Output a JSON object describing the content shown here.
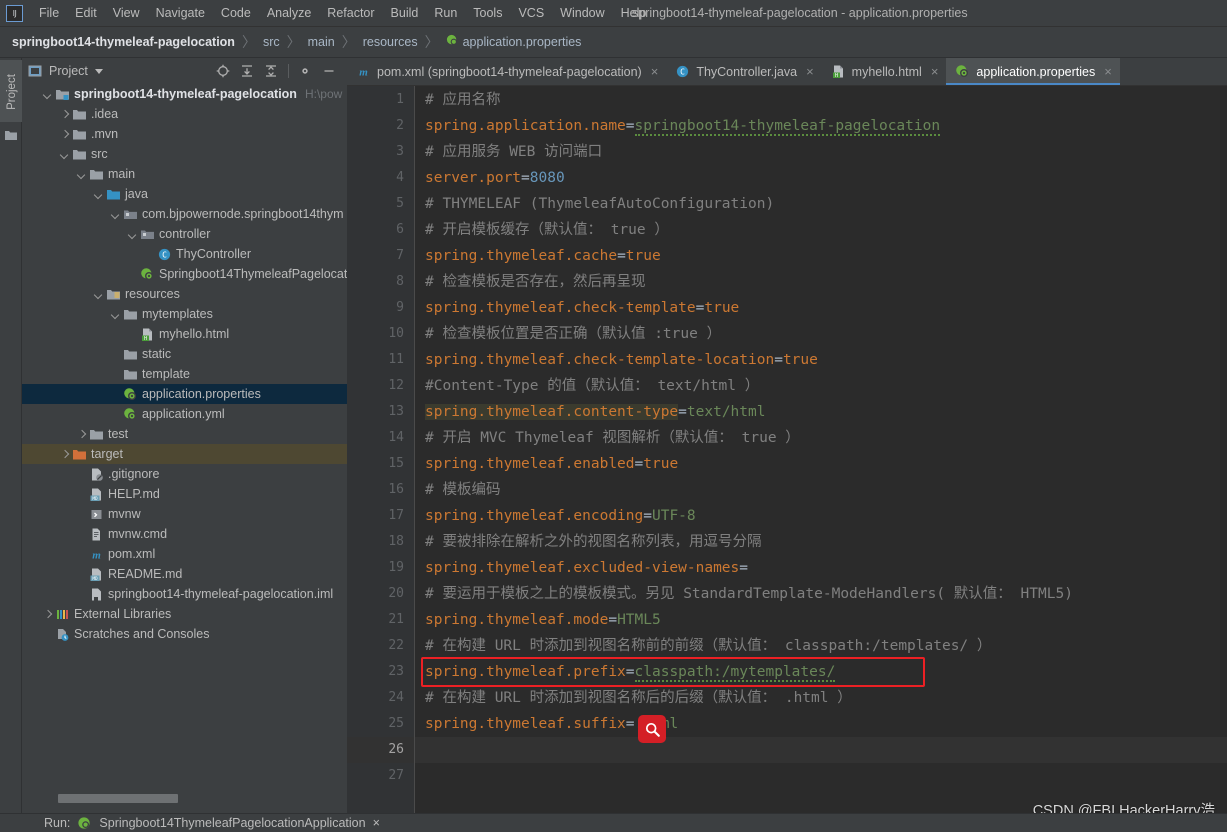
{
  "window": {
    "title": "springboot14-thymeleaf-pagelocation - application.properties",
    "logo": "intellij-idea-logo"
  },
  "menubar": {
    "items": [
      {
        "label": "File"
      },
      {
        "label": "Edit"
      },
      {
        "label": "View"
      },
      {
        "label": "Navigate"
      },
      {
        "label": "Code"
      },
      {
        "label": "Analyze"
      },
      {
        "label": "Refactor"
      },
      {
        "label": "Build"
      },
      {
        "label": "Run"
      },
      {
        "label": "Tools"
      },
      {
        "label": "VCS"
      },
      {
        "label": "Window"
      },
      {
        "label": "Help"
      }
    ]
  },
  "breadcrumb": {
    "items": [
      "springboot14-thymeleaf-pagelocation",
      "src",
      "main",
      "resources",
      "application.properties"
    ]
  },
  "toolstrip": {
    "project_tab": "Project"
  },
  "project_panel": {
    "title": "Project",
    "tools": [
      "locate-icon",
      "expand-all-icon",
      "collapse-all-icon",
      "settings-icon",
      "hide-icon"
    ],
    "tree": [
      {
        "depth": 0,
        "arrow": "down",
        "icon": "module-folder-icon",
        "label": "springboot14-thymeleaf-pagelocation",
        "bold": true,
        "hint": "H:\\pow",
        "state": "none"
      },
      {
        "depth": 1,
        "arrow": "right",
        "icon": "folder-icon",
        "label": ".idea",
        "state": "none"
      },
      {
        "depth": 1,
        "arrow": "right",
        "icon": "folder-icon",
        "label": ".mvn",
        "state": "none"
      },
      {
        "depth": 1,
        "arrow": "down",
        "icon": "folder-icon",
        "label": "src",
        "state": "none"
      },
      {
        "depth": 2,
        "arrow": "down",
        "icon": "folder-icon",
        "label": "main",
        "state": "none"
      },
      {
        "depth": 3,
        "arrow": "down",
        "icon": "source-folder-icon",
        "label": "java",
        "state": "none"
      },
      {
        "depth": 4,
        "arrow": "down",
        "icon": "package-icon",
        "label": "com.bjpowernode.springboot14thym",
        "state": "none"
      },
      {
        "depth": 5,
        "arrow": "down",
        "icon": "package-icon",
        "label": "controller",
        "state": "none"
      },
      {
        "depth": 6,
        "arrow": "none",
        "icon": "java-class-icon",
        "label": "ThyController",
        "state": "none"
      },
      {
        "depth": 5,
        "arrow": "none",
        "icon": "spring-boot-icon",
        "label": "Springboot14ThymeleafPagelocat",
        "state": "none"
      },
      {
        "depth": 3,
        "arrow": "down",
        "icon": "resources-folder-icon",
        "label": "resources",
        "state": "none"
      },
      {
        "depth": 4,
        "arrow": "down",
        "icon": "folder-icon",
        "label": "mytemplates",
        "state": "none"
      },
      {
        "depth": 5,
        "arrow": "none",
        "icon": "html-file-icon",
        "label": "myhello.html",
        "state": "none"
      },
      {
        "depth": 4,
        "arrow": "none",
        "icon": "folder-icon",
        "label": "static",
        "state": "none"
      },
      {
        "depth": 4,
        "arrow": "none",
        "icon": "folder-icon",
        "label": "template",
        "state": "none"
      },
      {
        "depth": 4,
        "arrow": "none",
        "icon": "spring-boot-icon",
        "label": "application.properties",
        "state": "selected"
      },
      {
        "depth": 4,
        "arrow": "none",
        "icon": "spring-boot-icon",
        "label": "application.yml",
        "state": "none"
      },
      {
        "depth": 2,
        "arrow": "right",
        "icon": "folder-icon",
        "label": "test",
        "state": "none"
      },
      {
        "depth": 1,
        "arrow": "right",
        "icon": "target-folder-icon",
        "label": "target",
        "state": "highlighted"
      },
      {
        "depth": 2,
        "arrow": "none",
        "icon": "gitignore-icon",
        "label": ".gitignore",
        "state": "none"
      },
      {
        "depth": 2,
        "arrow": "none",
        "icon": "markdown-icon",
        "label": "HELP.md",
        "state": "none"
      },
      {
        "depth": 2,
        "arrow": "none",
        "icon": "script-icon",
        "label": "mvnw",
        "state": "none"
      },
      {
        "depth": 2,
        "arrow": "none",
        "icon": "cmd-file-icon",
        "label": "mvnw.cmd",
        "state": "none"
      },
      {
        "depth": 2,
        "arrow": "none",
        "icon": "maven-icon",
        "label": "pom.xml",
        "state": "none"
      },
      {
        "depth": 2,
        "arrow": "none",
        "icon": "markdown-icon",
        "label": "README.md",
        "state": "none"
      },
      {
        "depth": 2,
        "arrow": "none",
        "icon": "iml-file-icon",
        "label": "springboot14-thymeleaf-pagelocation.iml",
        "state": "none"
      },
      {
        "depth": 0,
        "arrow": "right",
        "icon": "external-libraries-icon",
        "label": "External Libraries",
        "state": "none"
      },
      {
        "depth": 0,
        "arrow": "none",
        "icon": "scratches-icon",
        "label": "Scratches and Consoles",
        "state": "none"
      }
    ]
  },
  "editor": {
    "tabs": [
      {
        "label": "pom.xml (springboot14-thymeleaf-pagelocation)",
        "icon": "maven-icon",
        "active": false,
        "close": "×"
      },
      {
        "label": "ThyController.java",
        "icon": "java-class-icon",
        "active": false,
        "close": "×"
      },
      {
        "label": "myhello.html",
        "icon": "html-file-icon",
        "active": false,
        "close": "×"
      },
      {
        "label": "application.properties",
        "icon": "spring-boot-icon",
        "active": true,
        "close": "×"
      }
    ],
    "current_line": 26,
    "total_lines": 27,
    "lines": [
      {
        "n": 1,
        "type": "comment",
        "text": "# 应用名称"
      },
      {
        "n": 2,
        "type": "prop",
        "key": "spring.application.name",
        "value": "springboot14-thymeleaf-pagelocation",
        "value_style": "green",
        "wavy": true
      },
      {
        "n": 3,
        "type": "comment",
        "text": "# 应用服务 WEB 访问端口"
      },
      {
        "n": 4,
        "type": "prop",
        "key": "server.port",
        "value": "8080",
        "value_style": "number"
      },
      {
        "n": 5,
        "type": "comment",
        "text": "# THYMELEAF (ThymeleafAutoConfiguration)"
      },
      {
        "n": 6,
        "type": "comment",
        "text": "# 开启模板缓存（默认值： true ）"
      },
      {
        "n": 7,
        "type": "prop",
        "key": "spring.thymeleaf.cache",
        "value": "true",
        "value_style": "orange"
      },
      {
        "n": 8,
        "type": "comment",
        "text": "# 检查模板是否存在，然后再呈现"
      },
      {
        "n": 9,
        "type": "prop",
        "key": "spring.thymeleaf.check-template",
        "value": "true",
        "value_style": "orange"
      },
      {
        "n": 10,
        "type": "comment",
        "text": "# 检查模板位置是否正确（默认值 :true ）"
      },
      {
        "n": 11,
        "type": "prop",
        "key": "spring.thymeleaf.check-template-location",
        "value": "true",
        "value_style": "orange"
      },
      {
        "n": 12,
        "type": "comment",
        "text": "#Content-Type 的值（默认值： text/html ）"
      },
      {
        "n": 13,
        "type": "prop",
        "key": "spring.thymeleaf.content-type",
        "value": "text/html",
        "value_style": "green",
        "key_highlight": true
      },
      {
        "n": 14,
        "type": "comment",
        "text": "# 开启 MVC Thymeleaf 视图解析（默认值： true ）"
      },
      {
        "n": 15,
        "type": "prop",
        "key": "spring.thymeleaf.enabled",
        "value": "true",
        "value_style": "orange"
      },
      {
        "n": 16,
        "type": "comment",
        "text": "# 模板编码"
      },
      {
        "n": 17,
        "type": "prop",
        "key": "spring.thymeleaf.encoding",
        "value": "UTF-8",
        "value_style": "green"
      },
      {
        "n": 18,
        "type": "comment",
        "text": "# 要被排除在解析之外的视图名称列表，用逗号分隔"
      },
      {
        "n": 19,
        "type": "prop",
        "key": "spring.thymeleaf.excluded-view-names",
        "value": "",
        "value_style": "green"
      },
      {
        "n": 20,
        "type": "comment",
        "text": "# 要运用于模板之上的模板模式。另见 StandardTemplate-ModeHandlers( 默认值： HTML5)"
      },
      {
        "n": 21,
        "type": "prop",
        "key": "spring.thymeleaf.mode",
        "value": "HTML5",
        "value_style": "green"
      },
      {
        "n": 22,
        "type": "comment",
        "text": "# 在构建 URL 时添加到视图名称前的前缀（默认值： classpath:/templates/ ）"
      },
      {
        "n": 23,
        "type": "prop",
        "key": "spring.thymeleaf.prefix",
        "value": "classpath:/mytemplates/",
        "value_style": "green",
        "wavy": true,
        "annotated": true
      },
      {
        "n": 24,
        "type": "comment",
        "text": "# 在构建 URL 时添加到视图名称后的后缀（默认值： .html ）"
      },
      {
        "n": 25,
        "type": "prop",
        "key": "spring.thymeleaf.suffix",
        "value": ".html",
        "value_style": "green"
      },
      {
        "n": 26,
        "type": "blank",
        "text": ""
      },
      {
        "n": 27,
        "type": "blank",
        "text": ""
      }
    ]
  },
  "cursor": {
    "icon": "magnifier-icon",
    "color": "#d41f26"
  },
  "annotation": {
    "color": "#ec2024",
    "target_line": 23
  },
  "watermark": {
    "text": "CSDN @FBI HackerHarry浩"
  },
  "runbar": {
    "label": "Run:",
    "config": "Springboot14ThymeleafPagelocationApplication",
    "close": "×"
  },
  "colors": {
    "chrome": "#3c3f41",
    "editor_bg": "#2b2b2b",
    "gutter_bg": "#313335",
    "key": "#cc7832",
    "value_green": "#6a8759",
    "value_number": "#6897bb",
    "comment": "#808080",
    "selection_blue": "#0d293e",
    "highlight_olive": "#4e4832",
    "accent": "#4a88c7"
  }
}
